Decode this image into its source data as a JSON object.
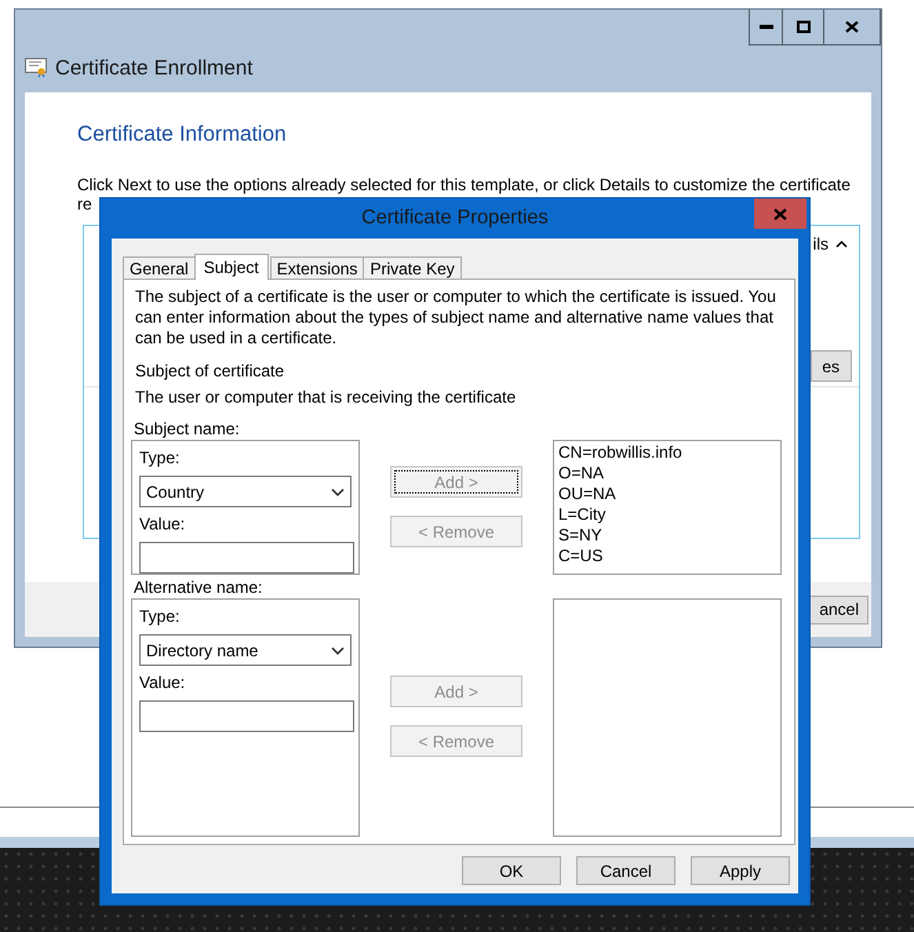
{
  "background_window": {
    "title": "Certificate Enrollment",
    "heading": "Certificate Information",
    "instruction_lines": [
      "Click Next to use the options already selected for this template, or click Details to customize the certificate",
      "re"
    ],
    "details_toggle": "ils",
    "properties_button": "es",
    "cancel_button": "ancel"
  },
  "dialog": {
    "title": "Certificate Properties",
    "tabs": [
      {
        "label": "General",
        "selected": false
      },
      {
        "label": "Subject",
        "selected": true
      },
      {
        "label": "Extensions",
        "selected": false
      },
      {
        "label": "Private Key",
        "selected": false
      }
    ],
    "description": "The subject of a certificate is the user or computer to which the certificate is issued. You can enter information about the types of subject name and alternative name values that can be used in a certificate.",
    "subject_heading": "Subject of certificate",
    "subject_subtext": "The user or computer that is receiving the certificate",
    "sections": [
      {
        "label": "Subject name:",
        "type_label": "Type:",
        "type_value": "Country",
        "value_label": "Value:",
        "add_button": {
          "label": "Add >",
          "disabled": true,
          "focused": true
        },
        "remove_button": {
          "label": "< Remove",
          "disabled": true,
          "focused": false
        },
        "entries": [
          "CN=robwillis.info",
          "O=NA",
          "OU=NA",
          "L=City",
          "S=NY",
          "C=US"
        ]
      },
      {
        "label": "Alternative name:",
        "type_label": "Type:",
        "type_value": "Directory name",
        "value_label": "Value:",
        "add_button": {
          "label": "Add >",
          "disabled": true,
          "focused": false
        },
        "remove_button": {
          "label": "< Remove",
          "disabled": true,
          "focused": false
        }
      }
    ],
    "buttons": [
      {
        "label": "OK"
      },
      {
        "label": "Cancel"
      },
      {
        "label": "Apply"
      }
    ]
  }
}
